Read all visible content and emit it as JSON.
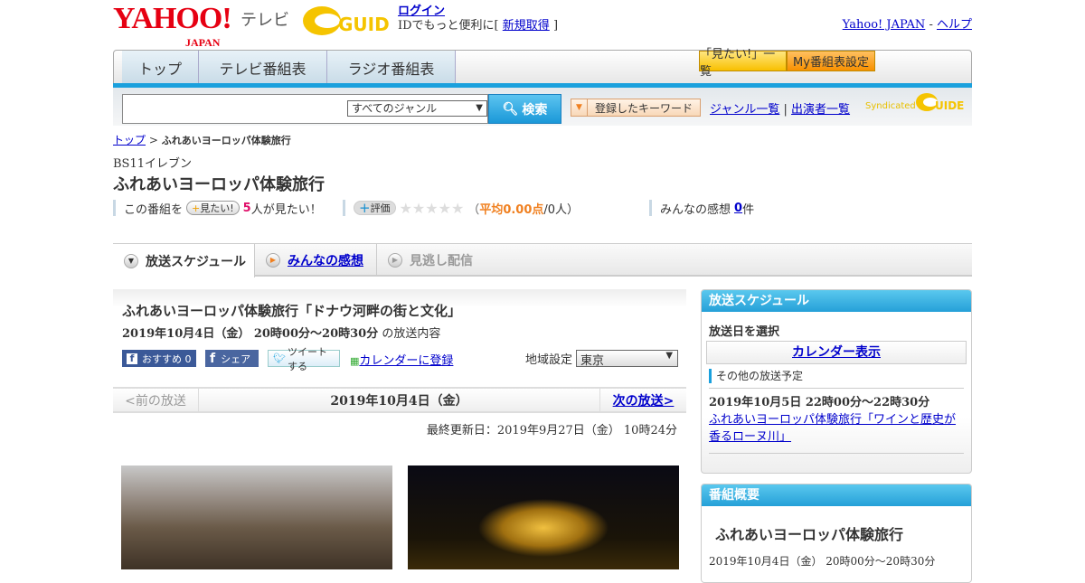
{
  "header": {
    "logo": "YAHOO!",
    "logo_sub": "JAPAN",
    "service": "テレビ",
    "gguide_logo": "G-GUIDE",
    "login": "ログイン",
    "login_note": "IDでもっと便利に[",
    "signup": "新規取得",
    "login_note_end": "]",
    "yahoo_japan": "Yahoo! JAPAN",
    "sep": "-",
    "help": "ヘルプ"
  },
  "nav": {
    "tabs": [
      "トップ",
      "テレビ番組表",
      "ラジオ番組表"
    ],
    "want_list": "「見たい!」一覧",
    "my_settings": "My番組表設定"
  },
  "search": {
    "value": "",
    "genre": "すべてのジャンル",
    "button": "検索",
    "keywords": "登録したキーワード",
    "genre_list": "ジャンル一覧",
    "sep": "|",
    "cast_list": "出演者一覧",
    "syndicated": "Syndicated"
  },
  "breadcrumb": {
    "top": "トップ",
    "sep": ">",
    "current": "ふれあいヨーロッパ体験旅行"
  },
  "program": {
    "channel": "BS11イレブン",
    "title": "ふれあいヨーロッパ体験旅行",
    "want_prefix": "この番組を",
    "want_btn": "見たい!",
    "want_count": "5",
    "want_suffix": "人が見たい！",
    "rate_btn": "評価",
    "stars": "★★★★★",
    "avg_open": "（",
    "avg": "平均0.00点",
    "avg_rest": "/0人）",
    "impressions_label": "みんなの感想",
    "impressions_count": "0",
    "impressions_unit": "件"
  },
  "tabs": [
    "放送スケジュール",
    "みんなの感想",
    "見逃し配信"
  ],
  "episode": {
    "title": "ふれあいヨーロッパ体験旅行「ドナウ河畔の街と文化」",
    "time": "2019年10月4日（金） 20時00分～20時30分",
    "time_suffix": "の放送内容",
    "fb_recommend": "おすすめ 0",
    "fb_share": "シェア",
    "tweet": "ツイートする",
    "calendar": "カレンダーに登録",
    "region_label": "地域設定",
    "region": "東京"
  },
  "episode_nav": {
    "prev": "<前の放送",
    "date": "2019年10月4日（金）",
    "next": "次の放送>"
  },
  "last_updated": "最終更新日：2019年9月27日（金） 10時24分",
  "sidebar": {
    "schedule_title": "放送スケジュール",
    "select_date": "放送日を選択",
    "calendar": "カレンダー表示",
    "other_label": "その他の放送予定",
    "other_time": "2019年10月5日 22時00分～22時30分",
    "other_title": "ふれあいヨーロッパ体験旅行「ワインと歴史が香るローヌ川」",
    "summary_title": "番組概要",
    "summary_program": "ふれあいヨーロッパ体験旅行",
    "summary_time": "2019年10月4日（金） 20時00分～20時30分"
  }
}
